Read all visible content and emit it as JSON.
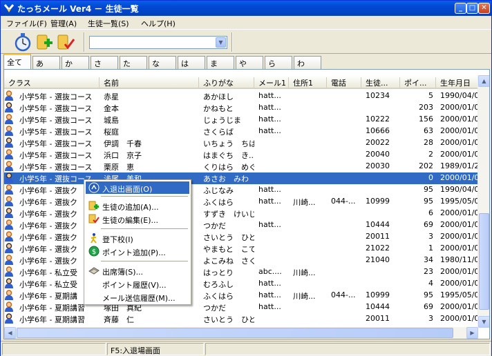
{
  "window": {
    "title": "たっちメール Ver4 － 生徒一覧",
    "minimize_label": "_",
    "maximize_label": "□",
    "close_label": "✕"
  },
  "menubar": {
    "items": [
      "ファイル(F)",
      "管理(A)",
      "生徒一覧(S)",
      "ヘルプ(H)"
    ]
  },
  "toolbar": {
    "combo_value": ""
  },
  "tabs": [
    "全て",
    "あ",
    "か",
    "さ",
    "た",
    "な",
    "は",
    "ま",
    "や",
    "ら",
    "わ"
  ],
  "list": {
    "columns": [
      "クラス",
      "名前",
      "ふりがな",
      "メール1",
      "住所1",
      "電話",
      "生徒...",
      "ポイ...",
      "生年月日"
    ],
    "rows": [
      {
        "class": "小学5年 - 選抜コース",
        "name": "赤星",
        "kana": "あかほし",
        "mail": "hatt...",
        "addr": "",
        "tel": "",
        "sid": "10234",
        "pt": "5",
        "birth": "1990/04/0"
      },
      {
        "class": "小学5年 - 選抜コース",
        "name": "金本",
        "kana": "かねもと",
        "mail": "hatt...",
        "addr": "",
        "tel": "",
        "sid": "",
        "pt": "203",
        "birth": "2000/01/0"
      },
      {
        "class": "小学5年 - 選抜コース",
        "name": "城島",
        "kana": "じょうじま",
        "mail": "hatt...",
        "addr": "",
        "tel": "",
        "sid": "10222",
        "pt": "156",
        "birth": "2000/01/0"
      },
      {
        "class": "小学5年 - 選抜コース",
        "name": "桜庭",
        "kana": "さくらば",
        "mail": "hatt...",
        "addr": "",
        "tel": "",
        "sid": "10666",
        "pt": "63",
        "birth": "2000/01/0"
      },
      {
        "class": "小学5年 - 選抜コース",
        "name": "伊調　千春",
        "kana": "いちょう　ちはる",
        "mail": "",
        "addr": "",
        "tel": "",
        "sid": "20022",
        "pt": "28",
        "birth": "2000/01/0"
      },
      {
        "class": "小学5年 - 選抜コース",
        "name": "浜口　京子",
        "kana": "はまぐち　き...",
        "mail": "",
        "addr": "",
        "tel": "",
        "sid": "20040",
        "pt": "2",
        "birth": "2000/01/0"
      },
      {
        "class": "小学5年 - 選抜コース",
        "name": "栗原　恵",
        "kana": "くりはら　めぐみ",
        "mail": "",
        "addr": "",
        "tel": "",
        "sid": "20030",
        "pt": "202",
        "birth": "1989/01/2"
      },
      {
        "class": "小学5年 - 選抜コース",
        "name": "浅尾　美和",
        "kana": "あさお　みわ",
        "mail": "",
        "addr": "",
        "tel": "",
        "sid": "",
        "pt": "0",
        "birth": "2000/01/0"
      },
      {
        "class": "小学6年 - 選抜ク",
        "name": "",
        "kana": "ふじなみ",
        "mail": "hatt...",
        "addr": "",
        "tel": "",
        "sid": "",
        "pt": "95",
        "birth": "1990/04/0"
      },
      {
        "class": "小学6年 - 選抜ク",
        "name": "",
        "kana": "ふくはら",
        "mail": "hatt...",
        "addr": "川崎...",
        "tel": "044-...",
        "sid": "10999",
        "pt": "95",
        "birth": "1995/05/0"
      },
      {
        "class": "小学6年 - 選抜ク",
        "name": "",
        "kana": "すずき　けいじ",
        "mail": "",
        "addr": "",
        "tel": "",
        "sid": "",
        "pt": "6",
        "birth": "2000/01/0"
      },
      {
        "class": "小学6年 - 選抜ク",
        "name": "",
        "kana": "つかだ",
        "mail": "hatt...",
        "addr": "",
        "tel": "",
        "sid": "10444",
        "pt": "69",
        "birth": "2000/01/0"
      },
      {
        "class": "小学6年 - 選抜ク",
        "name": "",
        "kana": "さいとう　ひとし",
        "mail": "",
        "addr": "",
        "tel": "",
        "sid": "20011",
        "pt": "3",
        "birth": "2000/01/0"
      },
      {
        "class": "小学6年 - 選抜ク",
        "name": "",
        "kana": "やまもと　こてつ",
        "mail": "",
        "addr": "",
        "tel": "",
        "sid": "21022",
        "pt": "1",
        "birth": "2000/01/0"
      },
      {
        "class": "小学6年 - 選抜ク",
        "name": "",
        "kana": "よこみね　さくら",
        "mail": "",
        "addr": "",
        "tel": "",
        "sid": "21040",
        "pt": "34",
        "birth": "1980/11/0"
      },
      {
        "class": "小学6年 - 私立受",
        "name": "",
        "kana": "はっとり",
        "mail": "abc....",
        "addr": "川崎...",
        "tel": "",
        "sid": "",
        "pt": "23",
        "birth": "2000/01/0"
      },
      {
        "class": "小学6年 - 私立受",
        "name": "",
        "kana": "むろふし",
        "mail": "hatt...",
        "addr": "",
        "tel": "",
        "sid": "",
        "pt": "4",
        "birth": "2000/01/0"
      },
      {
        "class": "小学6年 - 夏期講",
        "name": "",
        "kana": "ふくはら",
        "mail": "hatt...",
        "addr": "川崎...",
        "tel": "044-...",
        "sid": "10999",
        "pt": "95",
        "birth": "1995/05/0"
      },
      {
        "class": "小学6年 - 夏期講習",
        "name": "塚田　真紀",
        "kana": "つかだ",
        "mail": "hatt...",
        "addr": "",
        "tel": "",
        "sid": "10444",
        "pt": "69",
        "birth": "2000/01/0"
      },
      {
        "class": "小学6年 - 夏期講習",
        "name": "斉藤　仁",
        "kana": "さいとう　ひとし",
        "mail": "",
        "addr": "",
        "tel": "",
        "sid": "20011",
        "pt": "3",
        "birth": "2000/01/0"
      }
    ]
  },
  "context_menu": {
    "items": [
      {
        "label": "入退出画面(O)",
        "icon": "enter-exit-icon"
      },
      {
        "label": "生徒の追加(A)...",
        "icon": "add-student-icon"
      },
      {
        "label": "生徒の編集(E)...",
        "icon": "edit-student-icon"
      },
      {
        "label": "登下校(I)",
        "icon": "walking-person-icon"
      },
      {
        "label": "ポイント追加(P)...",
        "icon": "point-coin-icon"
      },
      {
        "label": "出席簿(S)...",
        "icon": "attendance-book-icon"
      },
      {
        "label": "ポイント履歴(V)...",
        "icon": ""
      },
      {
        "label": "メール送信履歴(M)...",
        "icon": ""
      }
    ]
  },
  "statusbar": {
    "cell1": "",
    "cell2": "F5:入退場画面",
    "cell3": ""
  },
  "colors": {
    "selection": "#316ac5",
    "titlebar": "#0347d3"
  }
}
